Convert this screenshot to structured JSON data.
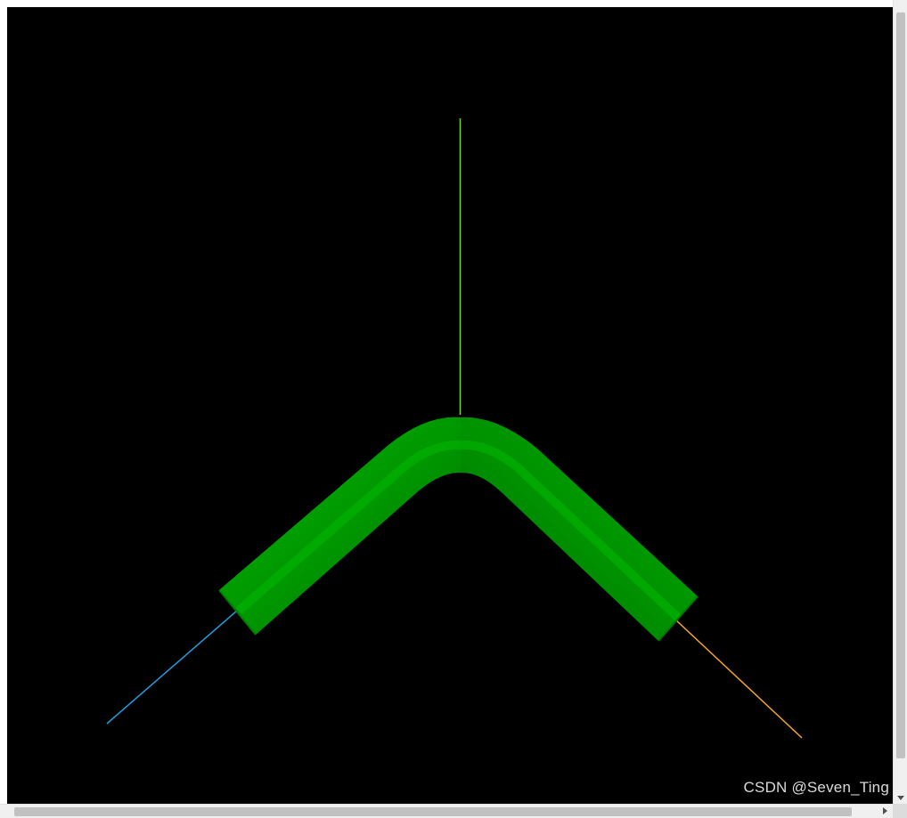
{
  "scene": {
    "background_color": "#000000",
    "tube_color": "#00a000",
    "tube_shadow_color": "#005a00",
    "axis_y_color": "#7ed321",
    "axis_x_color": "#f5a623",
    "axis_z_color": "#1e9fe0"
  },
  "icons": {
    "scroll_down": "chevron-down-icon",
    "scroll_right": "chevron-right-icon"
  },
  "watermark": {
    "text": "CSDN @Seven_Ting"
  }
}
